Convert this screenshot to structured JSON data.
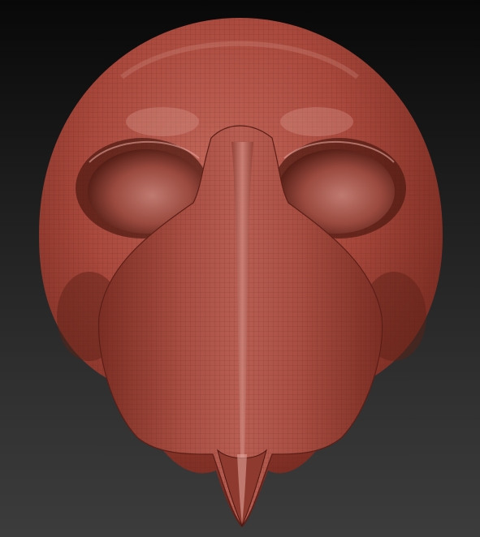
{
  "viewport": {
    "background_top": "#080808",
    "background_bottom": "#3c3c3c"
  },
  "model": {
    "material_color": "#a9483c",
    "shadow_color": "#3a120d",
    "highlight_color": "#e2a39b",
    "wireframe_color": "#5a1f17"
  }
}
